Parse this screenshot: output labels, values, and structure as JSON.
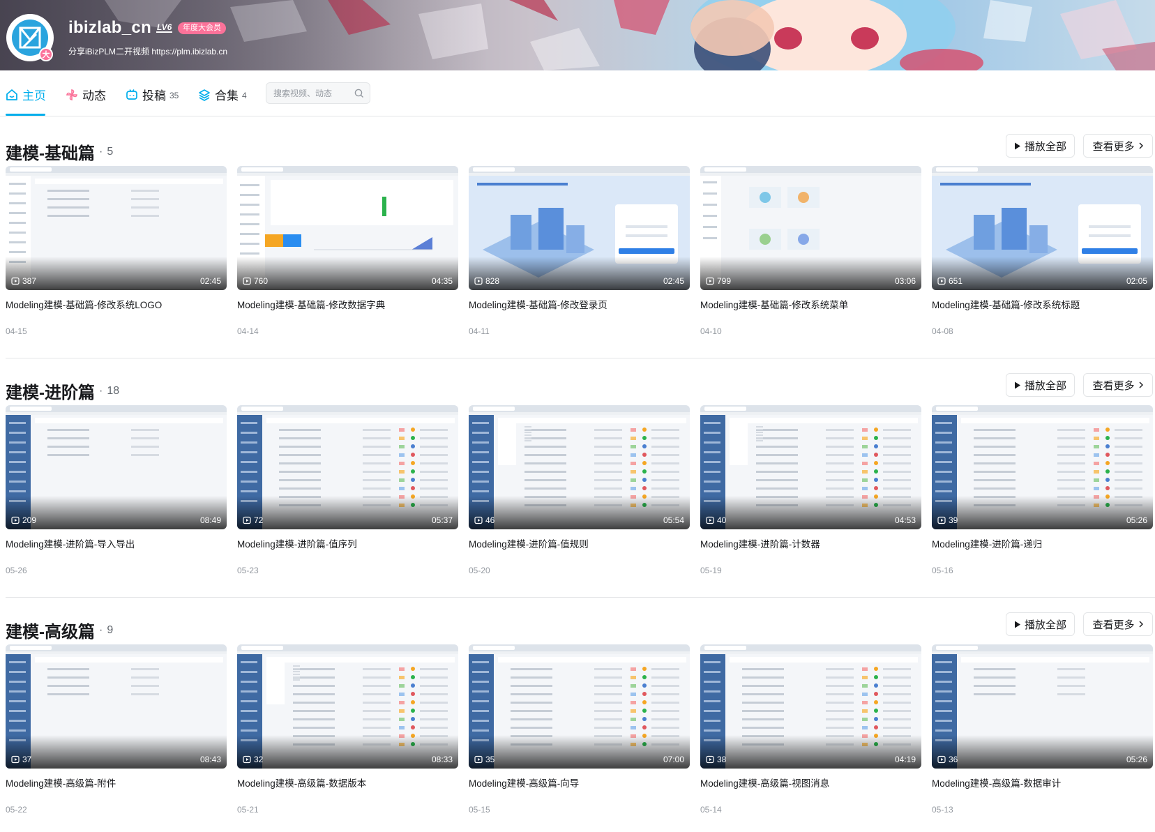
{
  "profile": {
    "username": "ibizlab_cn",
    "level": "LV6",
    "vip": "年度大会员",
    "sign": "分享iBizPLM二开视频 https://plm.ibizlab.cn",
    "avatar_badge": "大"
  },
  "nav": {
    "tabs": [
      {
        "label": "主页",
        "count": "",
        "icon": "home-icon",
        "active": true
      },
      {
        "label": "动态",
        "count": "",
        "icon": "pinwheel-icon",
        "active": false
      },
      {
        "label": "投稿",
        "count": "35",
        "icon": "tv-icon",
        "active": false
      },
      {
        "label": "合集",
        "count": "4",
        "icon": "layers-icon",
        "active": false
      }
    ],
    "search_placeholder": "搜索视频、动态"
  },
  "colors": {
    "accent": "#00aeec",
    "pink": "#fb7299",
    "divider": "#e3e5e7",
    "muted": "#9499a0"
  },
  "sections": [
    {
      "title": "建模-基础篇",
      "count": "5",
      "play_all": "播放全部",
      "more": "查看更多",
      "videos": [
        {
          "views": "387",
          "duration": "02:45",
          "title": "Modeling建模-基础篇-修改系统LOGO",
          "date": "04-15",
          "style": "app"
        },
        {
          "views": "760",
          "duration": "04:35",
          "title": "Modeling建模-基础篇-修改数据字典",
          "date": "04-14",
          "style": "chart"
        },
        {
          "views": "828",
          "duration": "02:45",
          "title": "Modeling建模-基础篇-修改登录页",
          "date": "04-11",
          "style": "login"
        },
        {
          "views": "799",
          "duration": "03:06",
          "title": "Modeling建模-基础篇-修改系统菜单",
          "date": "04-10",
          "style": "tiles"
        },
        {
          "views": "651",
          "duration": "02:05",
          "title": "Modeling建模-基础篇-修改系统标题",
          "date": "04-08",
          "style": "login"
        }
      ]
    },
    {
      "title": "建模-进阶篇",
      "count": "18",
      "play_all": "播放全部",
      "more": "查看更多",
      "videos": [
        {
          "views": "209",
          "duration": "08:49",
          "title": "Modeling建模-进阶篇-导入导出",
          "date": "05-26",
          "style": "sidebar"
        },
        {
          "views": "72",
          "duration": "05:37",
          "title": "Modeling建模-进阶篇-值序列",
          "date": "05-23",
          "style": "table"
        },
        {
          "views": "46",
          "duration": "05:54",
          "title": "Modeling建模-进阶篇-值规则",
          "date": "05-20",
          "style": "list"
        },
        {
          "views": "40",
          "duration": "04:53",
          "title": "Modeling建模-进阶篇-计数器",
          "date": "05-19",
          "style": "list"
        },
        {
          "views": "39",
          "duration": "05:26",
          "title": "Modeling建模-进阶篇-递归",
          "date": "05-16",
          "style": "table"
        }
      ]
    },
    {
      "title": "建模-高级篇",
      "count": "9",
      "play_all": "播放全部",
      "more": "查看更多",
      "videos": [
        {
          "views": "37",
          "duration": "08:43",
          "title": "Modeling建模-高级篇-附件",
          "date": "05-22",
          "style": "sidebar"
        },
        {
          "views": "32",
          "duration": "08:33",
          "title": "Modeling建模-高级篇-数据版本",
          "date": "05-21",
          "style": "list"
        },
        {
          "views": "35",
          "duration": "07:00",
          "title": "Modeling建模-高级篇-向导",
          "date": "05-15",
          "style": "table"
        },
        {
          "views": "38",
          "duration": "04:19",
          "title": "Modeling建模-高级篇-视图消息",
          "date": "05-14",
          "style": "table"
        },
        {
          "views": "36",
          "duration": "05:26",
          "title": "Modeling建模-高级篇-数据审计",
          "date": "05-13",
          "style": "sidebar"
        }
      ]
    }
  ]
}
